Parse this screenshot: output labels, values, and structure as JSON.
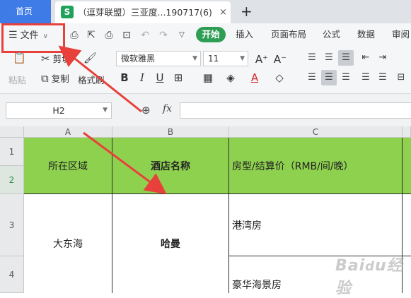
{
  "tabs": {
    "home": "首页",
    "doc_icon": "S",
    "doc_title": "（逗芽联盟）三亚度...190717(6)",
    "doc_status_icon": "saved-check-icon",
    "close": "×",
    "new_tab": "+"
  },
  "ribbon": {
    "file_menu": "文件",
    "tabs": [
      "开始",
      "插入",
      "页面布局",
      "公式",
      "数据",
      "审阅"
    ],
    "paste": "粘贴",
    "cut": "剪切",
    "copy": "复制",
    "format_painter": "格式刷",
    "font_name": "微软雅黑",
    "font_size": "11",
    "grow_font": "A⁺",
    "shrink_font": "A⁻",
    "bold": "B",
    "italic": "I",
    "underline": "U"
  },
  "formula_bar": {
    "name_box": "H2",
    "fx": "fx",
    "value": ""
  },
  "grid": {
    "columns": [
      "A",
      "B",
      "C"
    ],
    "rows": [
      "1",
      "2",
      "3",
      "4"
    ],
    "header_row": {
      "region": "所在区域",
      "hotel": "酒店名称",
      "room": "房型/结算价（RMB/间/晚）"
    },
    "body": {
      "region": "大东海",
      "hotel": "哈曼",
      "room_1": "港湾房",
      "room_2": "豪华海景房"
    }
  },
  "colors": {
    "header_fill": "#8ed14f",
    "start_tab": "#2f9e54",
    "home_tab": "#3e7be6",
    "annotation": "#e8403a"
  }
}
